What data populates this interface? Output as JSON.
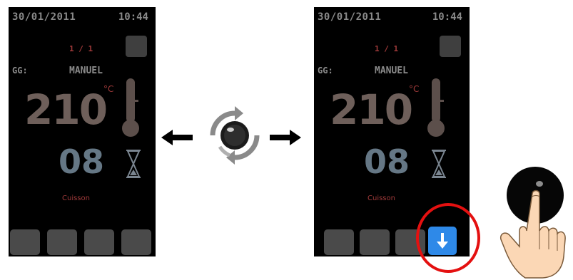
{
  "left_screen": {
    "date": "30/01/2011",
    "time": "10:44",
    "page": "1 / 1",
    "mode_key": "GG:",
    "mode_value": "MANUEL",
    "temperature": "210",
    "unit": "°C",
    "timer": "08",
    "status": "Cuisson",
    "buttons": [
      "",
      "",
      "",
      ""
    ]
  },
  "right_screen": {
    "date": "30/01/2011",
    "time": "10:44",
    "page": "1 / 1",
    "mode_key": "GG:",
    "mode_value": "MANUEL",
    "temperature": "210",
    "unit": "°C",
    "timer": "08",
    "status": "Cuisson",
    "buttons": [
      "",
      "",
      ""
    ],
    "action_button_icon": "down-arrow-icon"
  },
  "icons": {
    "left_arrow": "left-arrow-icon",
    "right_arrow": "right-arrow-icon",
    "rotate_knob": "rotary-knob-icon",
    "thermometer": "thermometer-icon",
    "hourglass": "hourglass-icon",
    "press_hand": "press-hand-icon"
  },
  "colors": {
    "highlight": "#e41010",
    "action_button": "#2e89e8",
    "temperature_text": "#6e5f5a",
    "timer_text": "#657785",
    "status_text": "#a03a3a"
  }
}
